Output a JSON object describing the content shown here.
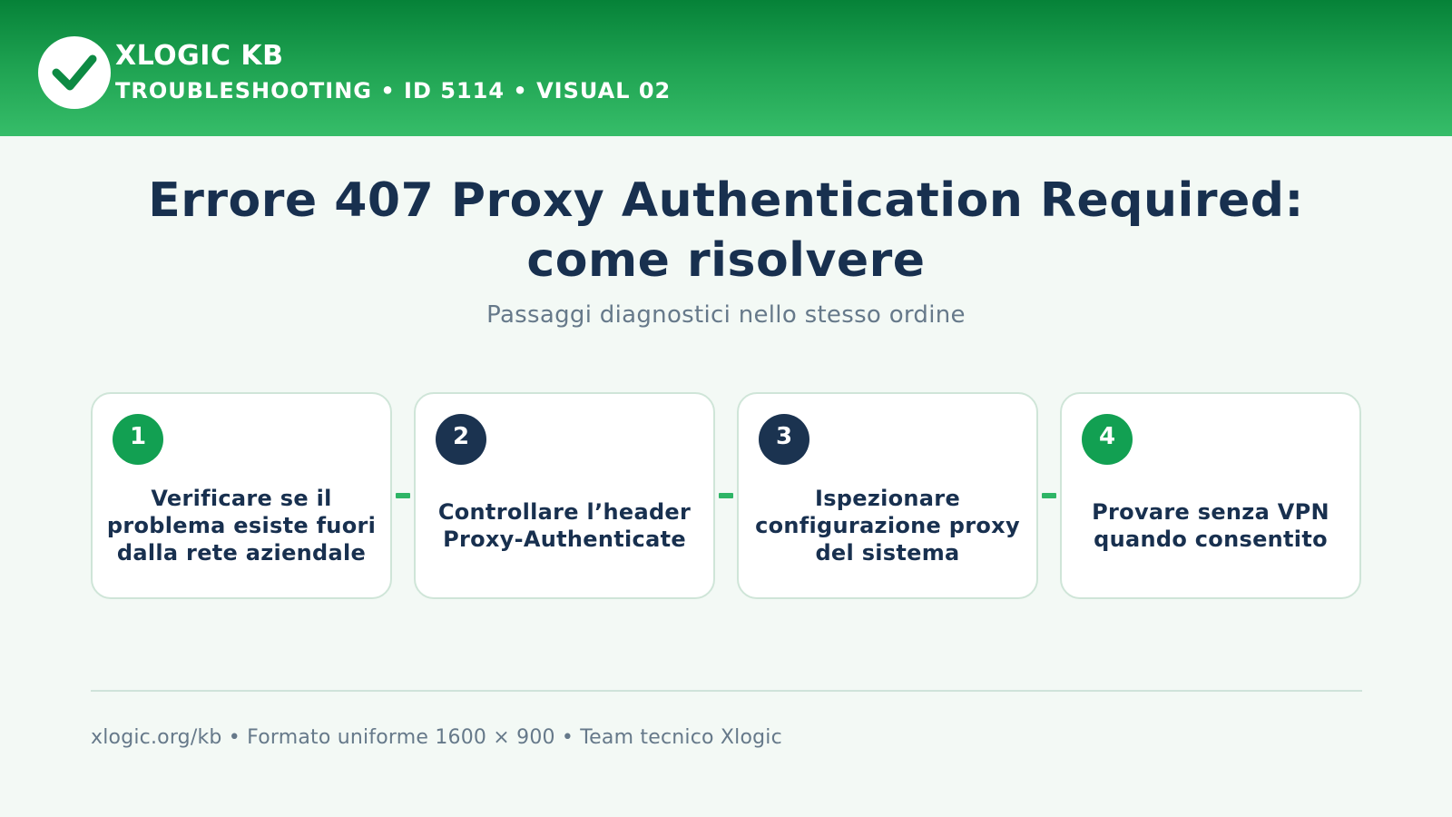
{
  "header": {
    "logo_icon": "checkmark-icon",
    "brand": "XLOGIC KB",
    "subtitle": "TROUBLESHOOTING • ID 5114 • VISUAL 02"
  },
  "title": "Errore 407 Proxy Authentication Required: come risolvere",
  "subtitle": "Passaggi diagnostici nello stesso ordine",
  "steps": [
    {
      "number": "1",
      "text": "Verificare se il problema esiste fuori dalla rete aziendale"
    },
    {
      "number": "2",
      "text": "Controllare l’header Proxy-Authenticate"
    },
    {
      "number": "3",
      "text": "Ispezionare configurazione proxy del sistema"
    },
    {
      "number": "4",
      "text": "Provare senza VPN quando consentito"
    }
  ],
  "footer": "xlogic.org/kb • Formato uniforme 1600 × 900 • Team tecnico Xlogic",
  "colors": {
    "brand_green": "#12a052",
    "navy": "#18304f",
    "muted": "#66798a",
    "background": "#f3f9f5"
  }
}
